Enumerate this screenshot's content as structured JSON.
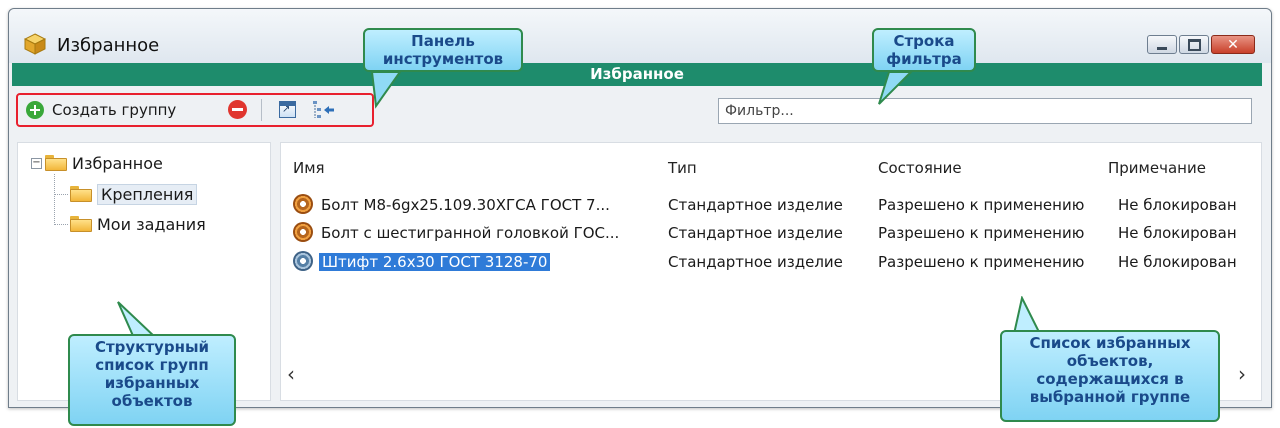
{
  "window": {
    "title": "Избранное"
  },
  "header": {
    "title": "Избранное"
  },
  "toolbar": {
    "create_group_label": "Создать группу"
  },
  "filter": {
    "placeholder": "Фильтр..."
  },
  "tree": {
    "items": [
      {
        "label": "Избранное",
        "expanded": true
      },
      {
        "label": "Крепления",
        "selected": true
      },
      {
        "label": "Мои задания"
      }
    ]
  },
  "list": {
    "columns": [
      "Имя",
      "Тип",
      "Состояние",
      "Примечание"
    ],
    "rows": [
      {
        "name": "Болт М8-6gx25.109.30ХГСА ГОСТ 7...",
        "type": "Стандартное изделие",
        "state": "Разрешено к применению",
        "note": "Не блокирован",
        "icon": "gear-orange-icon"
      },
      {
        "name": "Болт с шестигранной головкой ГОС...",
        "type": "Стандартное изделие",
        "state": "Разрешено к применению",
        "note": "Не блокирован",
        "icon": "gear-orange-icon"
      },
      {
        "name": "Штифт 2.6x30 ГОСТ 3128-70",
        "type": "Стандартное изделие",
        "state": "Разрешено к применению",
        "note": "Не блокирован",
        "icon": "gear-blue-icon",
        "selected": true
      }
    ]
  },
  "callouts": {
    "toolbar": "Панель инструментов",
    "filter": "Строка фильтра",
    "tree": "Структурный список групп избранных объектов",
    "list": "Список избранных объектов, содержащихся в выбранной группе"
  },
  "colors": {
    "header_bar": "#1e8c6c",
    "selection": "#2f7bd8",
    "callout_fill": "#9fe0f7",
    "callout_border": "#2f8a4d",
    "highlight_border": "#e8202e"
  }
}
